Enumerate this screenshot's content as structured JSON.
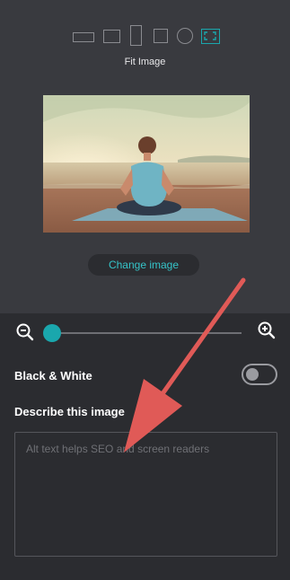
{
  "fit_options": {
    "label": "Fit Image",
    "shapes": [
      "landscape-rectangle",
      "square-wide",
      "portrait-rectangle",
      "square",
      "circle",
      "fit-image"
    ],
    "selected": "fit-image"
  },
  "preview": {
    "description_icon": "meditation-photo"
  },
  "change_image_label": "Change image",
  "zoom": {
    "level": 0,
    "zoom_out_icon": "zoom-out-icon",
    "zoom_in_icon": "zoom-in-icon"
  },
  "black_white": {
    "label": "Black & White",
    "enabled": false
  },
  "describe": {
    "label": "Describe this image",
    "placeholder": "Alt text helps SEO and screen readers",
    "value": ""
  },
  "colors": {
    "accent": "#1aa7ad",
    "annotation_arrow": "#e05a57"
  }
}
